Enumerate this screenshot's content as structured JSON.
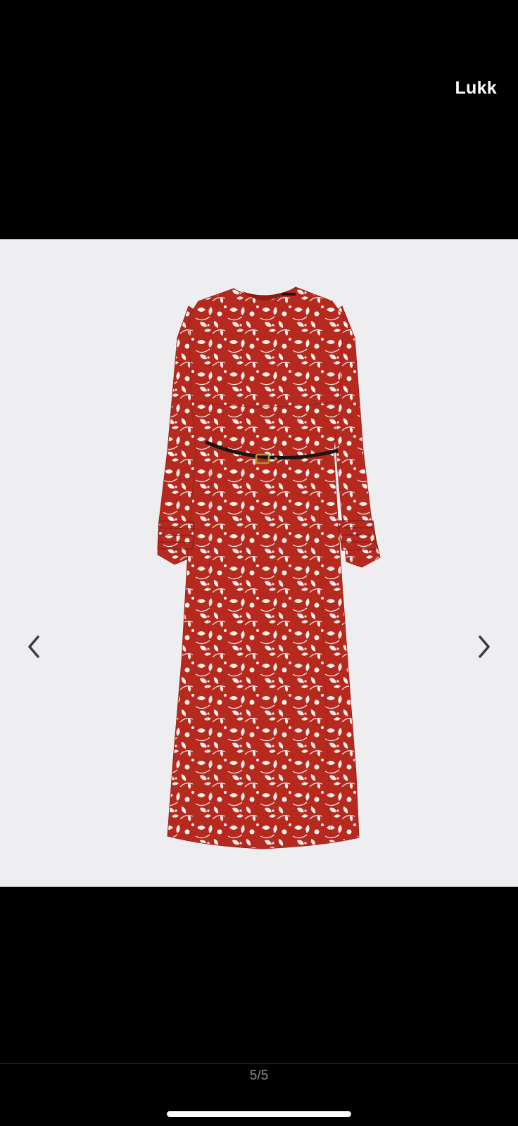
{
  "header": {
    "close_label": "Lukk"
  },
  "gallery": {
    "current": 5,
    "total": 5,
    "counter_text": "5/5",
    "prev_icon": "chevron-left-icon",
    "next_icon": "chevron-right-icon"
  },
  "colors": {
    "background": "#000000",
    "image_background": "#eeeef0",
    "dress_red": "#b5291f",
    "print_white": "#f4efea",
    "belt": "#1a1412",
    "counter_text": "#8c8c96",
    "arrow": "#3a3a40"
  }
}
